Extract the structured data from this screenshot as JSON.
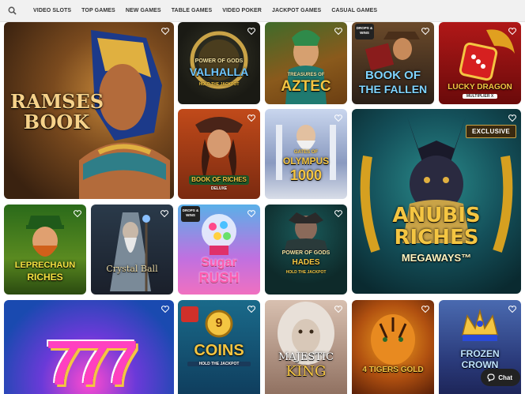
{
  "nav": {
    "search_icon": "search-icon",
    "items": [
      "VIDEO SLOTS",
      "TOP GAMES",
      "NEW GAMES",
      "TABLE GAMES",
      "VIDEO POKER",
      "JACKPOT GAMES",
      "CASUAL GAMES"
    ]
  },
  "games": {
    "ramses": {
      "title": "RAMSES BOOK"
    },
    "valhalla": {
      "line1": "POWER OF GODS",
      "line2": "VALHALLA",
      "sub": "HOLD THE JACKPOT"
    },
    "aztec": {
      "line1": "TREASURES OF",
      "line2": "AZTEC"
    },
    "fallen": {
      "badge": "DROPS & WINS",
      "line1": "BOOK OF",
      "line2": "THE FALLEN"
    },
    "dragon": {
      "line1": "LUCKY DRAGON",
      "sub": "MULTIPLIER X"
    },
    "riches": {
      "line1": "BOOK OF RICHES",
      "sub": "DELUXE"
    },
    "olympus": {
      "line1": "GATES OF",
      "line2": "OLYMPUS",
      "line3": "1000"
    },
    "anubis": {
      "badge": "EXCLUSIVE",
      "line1": "ANUBIS",
      "line2": "RICHES",
      "line3": "MEGAWAYS™"
    },
    "leprechaun": {
      "line1": "LEPRECHAUN",
      "line2": "RICHES"
    },
    "crystal": {
      "title": "Crystal Ball"
    },
    "sugar": {
      "badge": "DROPS & WINS",
      "line1": "Sugar",
      "line2": "RUSH"
    },
    "hades": {
      "line1": "POWER OF GODS",
      "line2": "HADES",
      "sub": "HOLD THE JACKPOT"
    },
    "sevens": {
      "title": "777"
    },
    "coins": {
      "line1": "9",
      "line2": "COINS",
      "sub": "HOLD THE JACKPOT"
    },
    "majestic": {
      "line1": "MAJESTIC",
      "line2": "KING"
    },
    "tigers": {
      "line1": "4 TIGERS GOLD"
    },
    "crown": {
      "line1": "FROZEN",
      "line2": "CROWN"
    }
  },
  "chat": {
    "label": "Chat"
  },
  "colors": {
    "gold": "#f4c542",
    "nav_bg": "#f1f1f1",
    "nav_text": "#333333"
  }
}
